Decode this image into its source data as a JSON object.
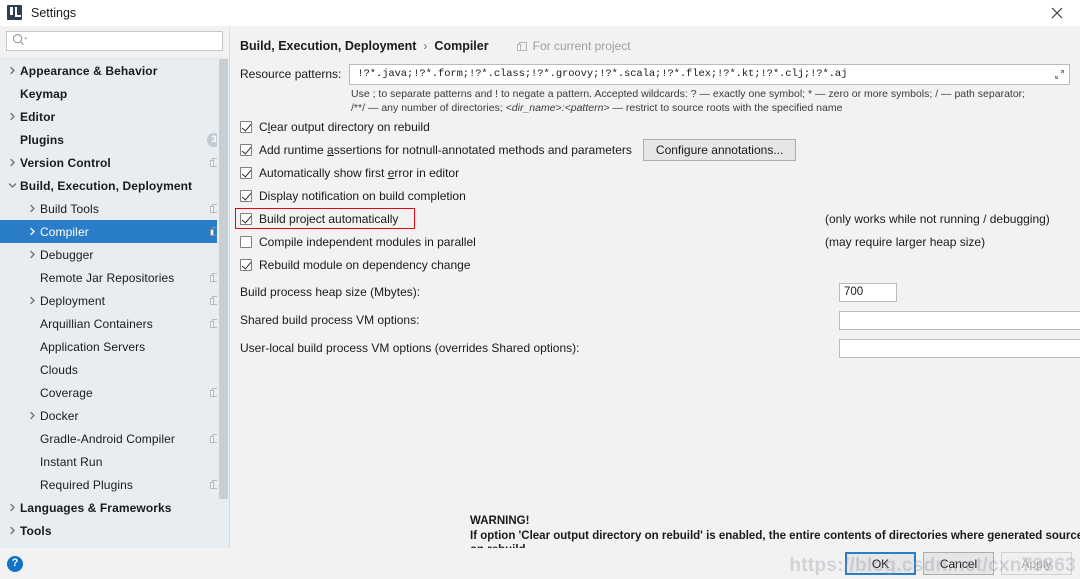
{
  "window": {
    "title": "Settings",
    "app_icon": "intellij-idea-icon",
    "close_icon": "close-icon"
  },
  "search": {
    "placeholder": "",
    "value": "",
    "icon": "search-icon"
  },
  "sidebar": {
    "items": [
      {
        "label": "Appearance & Behavior",
        "indent": 0,
        "arrow": "chevron-right",
        "bold": true,
        "badge": null,
        "project_icon": false,
        "selected": false
      },
      {
        "label": "Keymap",
        "indent": 0,
        "arrow": "none",
        "bold": true,
        "badge": null,
        "project_icon": false,
        "selected": false
      },
      {
        "label": "Editor",
        "indent": 0,
        "arrow": "chevron-right",
        "bold": true,
        "badge": null,
        "project_icon": false,
        "selected": false
      },
      {
        "label": "Plugins",
        "indent": 0,
        "arrow": "none",
        "bold": true,
        "badge": "3",
        "project_icon": false,
        "selected": false
      },
      {
        "label": "Version Control",
        "indent": 0,
        "arrow": "chevron-right",
        "bold": true,
        "badge": null,
        "project_icon": true,
        "selected": false
      },
      {
        "label": "Build, Execution, Deployment",
        "indent": 0,
        "arrow": "chevron-down",
        "bold": true,
        "badge": null,
        "project_icon": false,
        "selected": false
      },
      {
        "label": "Build Tools",
        "indent": 1,
        "arrow": "chevron-right",
        "bold": false,
        "badge": null,
        "project_icon": true,
        "selected": false
      },
      {
        "label": "Compiler",
        "indent": 1,
        "arrow": "chevron-right",
        "bold": false,
        "badge": null,
        "project_icon": true,
        "selected": true
      },
      {
        "label": "Debugger",
        "indent": 1,
        "arrow": "chevron-right",
        "bold": false,
        "badge": null,
        "project_icon": false,
        "selected": false
      },
      {
        "label": "Remote Jar Repositories",
        "indent": 1,
        "arrow": "none",
        "bold": false,
        "badge": null,
        "project_icon": true,
        "selected": false
      },
      {
        "label": "Deployment",
        "indent": 1,
        "arrow": "chevron-right",
        "bold": false,
        "badge": null,
        "project_icon": true,
        "selected": false
      },
      {
        "label": "Arquillian Containers",
        "indent": 1,
        "arrow": "none",
        "bold": false,
        "badge": null,
        "project_icon": true,
        "selected": false
      },
      {
        "label": "Application Servers",
        "indent": 1,
        "arrow": "none",
        "bold": false,
        "badge": null,
        "project_icon": false,
        "selected": false
      },
      {
        "label": "Clouds",
        "indent": 1,
        "arrow": "none",
        "bold": false,
        "badge": null,
        "project_icon": false,
        "selected": false
      },
      {
        "label": "Coverage",
        "indent": 1,
        "arrow": "none",
        "bold": false,
        "badge": null,
        "project_icon": true,
        "selected": false
      },
      {
        "label": "Docker",
        "indent": 1,
        "arrow": "chevron-right",
        "bold": false,
        "badge": null,
        "project_icon": false,
        "selected": false
      },
      {
        "label": "Gradle-Android Compiler",
        "indent": 1,
        "arrow": "none",
        "bold": false,
        "badge": null,
        "project_icon": true,
        "selected": false
      },
      {
        "label": "Instant Run",
        "indent": 1,
        "arrow": "none",
        "bold": false,
        "badge": null,
        "project_icon": false,
        "selected": false
      },
      {
        "label": "Required Plugins",
        "indent": 1,
        "arrow": "none",
        "bold": false,
        "badge": null,
        "project_icon": true,
        "selected": false
      },
      {
        "label": "Languages & Frameworks",
        "indent": 0,
        "arrow": "chevron-right",
        "bold": true,
        "badge": null,
        "project_icon": false,
        "selected": false
      },
      {
        "label": "Tools",
        "indent": 0,
        "arrow": "chevron-right",
        "bold": true,
        "badge": null,
        "project_icon": false,
        "selected": false
      }
    ]
  },
  "main": {
    "breadcrumb": {
      "parent": "Build, Execution, Deployment",
      "separator": "›",
      "current": "Compiler"
    },
    "scope_label": "For current project",
    "scope_icon": "project-scope-icon",
    "resource_patterns": {
      "label": "Resource patterns:",
      "value": "!?*.java;!?*.form;!?*.class;!?*.groovy;!?*.scala;!?*.flex;!?*.kt;!?*.clj;!?*.aj",
      "expand_icon": "expand-icon"
    },
    "hint_line1": "Use ; to separate patterns and ! to negate a pattern. Accepted wildcards: ? — exactly one symbol; * — zero or more symbols; / — path separator;",
    "hint_line2_pre": "/**/ — any number of directories; ",
    "hint_line2_italic": "<dir_name>:<pattern>",
    "hint_line2_post": " — restrict to source roots with the specified name",
    "checkboxes": [
      {
        "label": "Clear output directory on rebuild",
        "checked": true,
        "mnemonic": "l",
        "note": "",
        "highlighted": false
      },
      {
        "label": "Add runtime assertions for notnull-annotated methods and parameters",
        "checked": true,
        "mnemonic": "a",
        "note": "",
        "highlighted": false
      },
      {
        "label": "Automatically show first error in editor",
        "checked": true,
        "mnemonic": "e",
        "note": "",
        "highlighted": false
      },
      {
        "label": "Display notification on build completion",
        "checked": true,
        "mnemonic": "",
        "note": "",
        "highlighted": false
      },
      {
        "label": "Build project automatically",
        "checked": true,
        "mnemonic": "",
        "note": "(only works while not running / debugging)",
        "highlighted": true
      },
      {
        "label": "Compile independent modules in parallel",
        "checked": false,
        "mnemonic": "",
        "note": "(may require larger heap size)",
        "highlighted": false
      },
      {
        "label": "Rebuild module on dependency change",
        "checked": true,
        "mnemonic": "",
        "note": "",
        "highlighted": false
      }
    ],
    "configure_annotations_label": "Configure annotations...",
    "fields": [
      {
        "label": "Build process heap size (Mbytes):",
        "value": "700",
        "placeholder": ""
      },
      {
        "label": "Shared build process VM options:",
        "value": "",
        "placeholder": ""
      },
      {
        "label": "User-local build process VM options (overrides Shared options):",
        "value": "",
        "placeholder": ""
      }
    ],
    "warning": {
      "title": "WARNING!",
      "line1": "If option 'Clear output directory on rebuild' is enabled, the entire contents of directories where generated sources are stored WILL BE CLEARED",
      "line2": "on rebuild."
    }
  },
  "footer": {
    "help_icon": "help-icon",
    "help_glyph": "?",
    "ok_label": "OK",
    "cancel_label": "Cancel",
    "apply_label": "Apply"
  },
  "watermark": {
    "text": "https://blog.csdn.net/cxn73863"
  },
  "colors": {
    "accent": "#2a7dc9",
    "highlight": "#e60012",
    "sidebar_bg": "#e8edf2",
    "panel_bg": "#f2f2f2",
    "help_blue": "#1272c7"
  }
}
